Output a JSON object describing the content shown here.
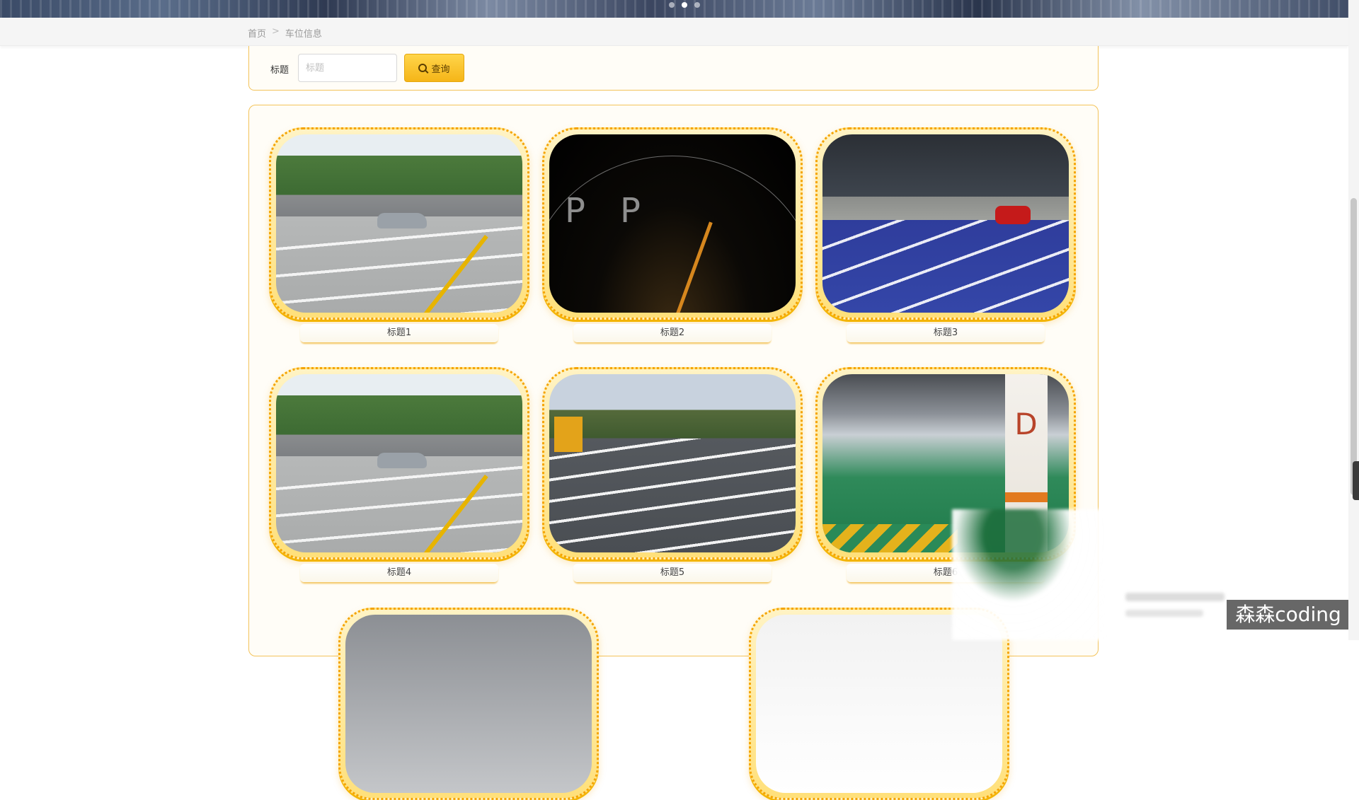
{
  "banner": {
    "carousel_dots": 3,
    "active_dot": 1
  },
  "breadcrumb": {
    "home": "首页",
    "separator": ">",
    "current": "车位信息"
  },
  "search": {
    "label": "标题",
    "placeholder": "标题",
    "value": "",
    "button_label": "查询"
  },
  "cards": [
    {
      "title": "标题1",
      "image": "outdoor-parking-lot"
    },
    {
      "title": "标题2",
      "image": "parking-graphic-dark"
    },
    {
      "title": "标题3",
      "image": "blue-parking-night"
    },
    {
      "title": "标题4",
      "image": "outdoor-parking-lot"
    },
    {
      "title": "标题5",
      "image": "open-parking-lot"
    },
    {
      "title": "标题6",
      "image": "underground-garage"
    },
    {
      "title": "",
      "image": "partial"
    },
    {
      "title": "",
      "image": "partial"
    }
  ],
  "scene_text": {
    "p1": "P",
    "p2": "P",
    "zone": "D"
  },
  "watermark": "森森coding",
  "colors": {
    "accent": "#f5b518",
    "border": "#f3c35a",
    "frame": "#f5a300"
  }
}
